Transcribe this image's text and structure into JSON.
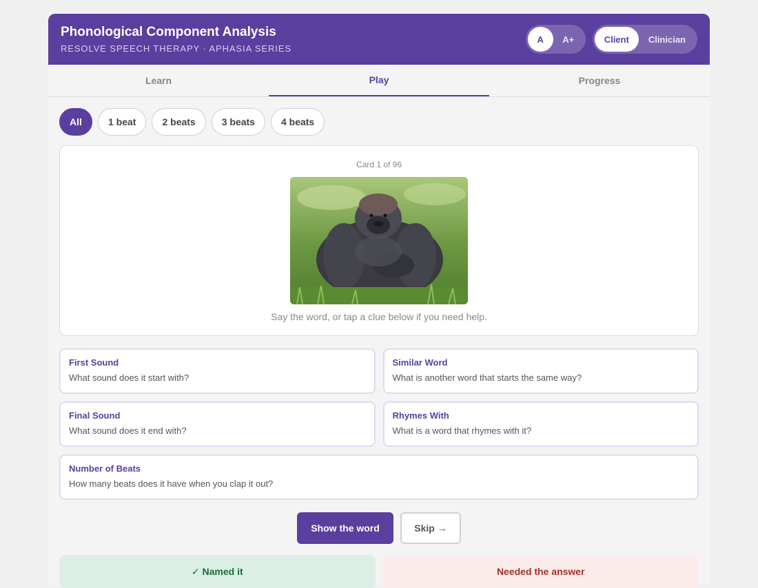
{
  "header": {
    "title": "Phonological Component Analysis",
    "subtitle": "RESOLVE SPEECH THERAPY · APHASIA SERIES",
    "font_small": "A",
    "font_large": "A+",
    "mode_client": "Client",
    "mode_clinician": "Clinician"
  },
  "tabs": [
    {
      "label": "Learn"
    },
    {
      "label": "Play"
    },
    {
      "label": "Progress"
    }
  ],
  "filters": [
    {
      "label": "All"
    },
    {
      "label": "1 beat"
    },
    {
      "label": "2 beats"
    },
    {
      "label": "3 beats"
    },
    {
      "label": "4 beats"
    }
  ],
  "card": {
    "counter": "Card 1 of 96",
    "prompt": "Say the word, or tap a clue below if you need help."
  },
  "clues": [
    {
      "title": "First Sound",
      "question": "What sound does it start with?"
    },
    {
      "title": "Similar Word",
      "question": "What is another word that starts the same way?"
    },
    {
      "title": "Final Sound",
      "question": "What sound does it end with?"
    },
    {
      "title": "Rhymes With",
      "question": "What is a word that rhymes with it?"
    },
    {
      "title": "Number of Beats",
      "question": "How many beats does it have when you clap it out?"
    }
  ],
  "actions": {
    "show": "Show the word",
    "skip": "Skip →"
  },
  "results": {
    "named": "✓ Named it",
    "needed": "Needed the answer"
  },
  "colors": {
    "brand": "#5a3f9e",
    "success_bg": "#dcefe4",
    "danger_bg": "#fbeceb"
  }
}
